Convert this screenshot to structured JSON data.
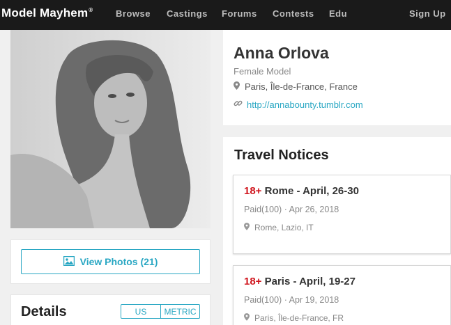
{
  "nav": {
    "logo": "Model Mayhem",
    "logo_mark": "®",
    "links": [
      "Browse",
      "Castings",
      "Forums",
      "Contests",
      "Edu"
    ],
    "signup": "Sign Up"
  },
  "profile": {
    "name": "Anna Orlova",
    "role": "Female Model",
    "location": "Paris, Île-de-France, France",
    "website": "http://annabounty.tumblr.com",
    "view_photos_label": "View Photos (21)"
  },
  "details": {
    "title": "Details",
    "unit_us": "US",
    "unit_metric": "METRIC"
  },
  "travel": {
    "title": "Travel Notices",
    "notices": [
      {
        "age": "18+",
        "title": "Rome - April, 26-30",
        "payment": "Paid(100)",
        "separator": "·",
        "date": "Apr 26, 2018",
        "location": "Rome, Lazio, IT"
      },
      {
        "age": "18+",
        "title": "Paris - April, 19-27",
        "payment": "Paid(100)",
        "separator": "·",
        "date": "Apr 19, 2018",
        "location": "Paris, Île-de-France, FR"
      }
    ]
  },
  "colors": {
    "accent": "#29a7c3",
    "age_red": "#d0161e",
    "nav_bg": "#1a1a1a"
  }
}
